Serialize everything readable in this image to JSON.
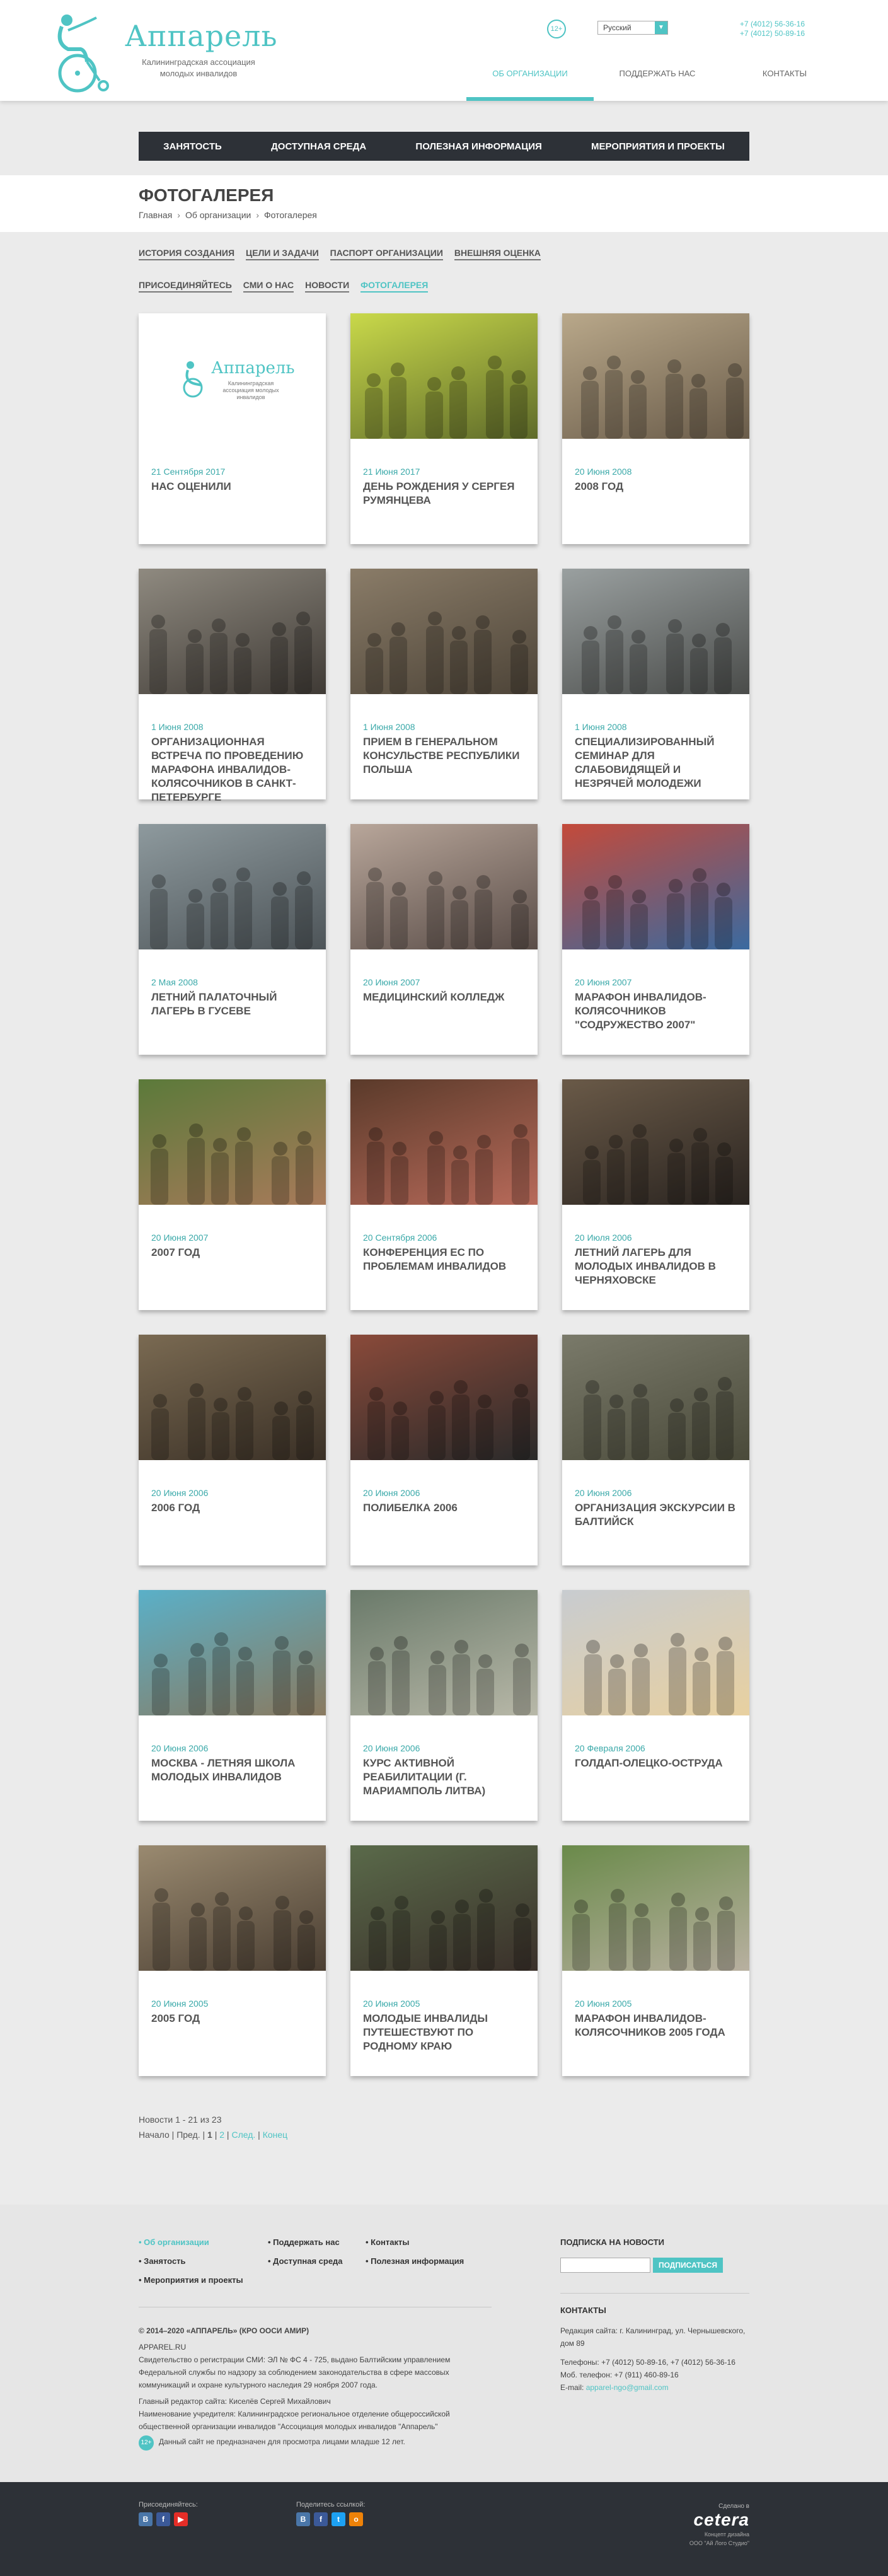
{
  "brand": {
    "name": "Аппарель",
    "subtitle": "Калининградская ассоциация молодых инвалидов",
    "age_badge": "12+",
    "language": "Русский",
    "phones": [
      "+7 (4012) 56-36-16",
      "+7 (4012) 50-89-16"
    ]
  },
  "top_nav": [
    "Об организации",
    "Поддержать нас",
    "Контакты"
  ],
  "section_nav": [
    "Занятость",
    "Доступная среда",
    "Полезная информация",
    "Мероприятия и проекты"
  ],
  "page": {
    "title": "Фотогалерея",
    "breadcrumb": [
      "Главная",
      "Об организации",
      "Фотогалерея"
    ]
  },
  "tabs_row1": [
    "История создания",
    "Цели и задачи",
    "Паспорт организации",
    "Внешняя оценка"
  ],
  "tabs_row2": [
    "Присоединяйтесь",
    "СМИ о нас",
    "Новости",
    "Фотогалерея"
  ],
  "gallery": [
    {
      "date": "21 Сентября 2017",
      "title": "Нас оценили"
    },
    {
      "date": "21 Июня 2017",
      "title": "День рождения у Сергея Румянцева"
    },
    {
      "date": "20 Июня 2008",
      "title": "2008 год"
    },
    {
      "date": "1 Июня 2008",
      "title": "Организационная встреча по проведению марафона инвалидов-колясочников в Санкт-Петербурге"
    },
    {
      "date": "1 Июня 2008",
      "title": "Прием в Генеральном Консульстве Республики Польша"
    },
    {
      "date": "1 Июня 2008",
      "title": "Специализированный семинар для слабовидящей и незрячей молодежи"
    },
    {
      "date": "2 Мая 2008",
      "title": "Летний палаточный лагерь в Гусеве"
    },
    {
      "date": "20 Июня 2007",
      "title": "Медицинский колледж"
    },
    {
      "date": "20 Июня 2007",
      "title": "Марафон инвалидов-колясочников \"Содружество 2007\""
    },
    {
      "date": "20 Июня 2007",
      "title": "2007 год"
    },
    {
      "date": "20 Сентября 2006",
      "title": "Конференция ЕС по проблемам инвалидов"
    },
    {
      "date": "20 Июля 2006",
      "title": "Летний лагерь для молодых инвалидов в Черняховске"
    },
    {
      "date": "20 Июня 2006",
      "title": "2006 год"
    },
    {
      "date": "20 Июня 2006",
      "title": "Полибелка 2006"
    },
    {
      "date": "20 Июня 2006",
      "title": "Организация экскурсии в Балтийск"
    },
    {
      "date": "20 Июня 2006",
      "title": "Москва - Летняя школа молодых инвалидов"
    },
    {
      "date": "20 Июня 2006",
      "title": "Курс активной реабилитации (г. Мариамполь Литва)"
    },
    {
      "date": "20 Февраля 2006",
      "title": "Голдап-Олецко-Оструда"
    },
    {
      "date": "20 Июня 2005",
      "title": "2005 год"
    },
    {
      "date": "20 Июня 2005",
      "title": "Молодые инвалиды путешествуют по родному краю"
    },
    {
      "date": "20 Июня 2005",
      "title": "Марафон инвалидов-колясочников 2005 года"
    }
  ],
  "pager": {
    "summary": "Новости 1 - 21 из 23",
    "start": "Начало",
    "prev": "Пред.",
    "page1": "1",
    "page2": "2",
    "next": "След.",
    "end": "Конец"
  },
  "footer": {
    "menu_col1": [
      "Об организации",
      "Занятость",
      "Мероприятия и проекты"
    ],
    "menu_col2": [
      "Поддержать нас",
      "Доступная среда"
    ],
    "menu_col3": [
      "Контакты",
      "Полезная информация"
    ],
    "copyright": "© 2014–2020 «АППАРЕЛЬ» (КРО ООСИ АМИР)",
    "site": "APPAREL.RU",
    "legal1": "Свидетельство о регистрации СМИ: ЭЛ № ФС 4 - 725, выдано Балтийским управлением Федеральной службы по надзору за соблюдением законодательства в сфере массовых коммуникаций и охране культурного наследия 29 ноября 2007 года.",
    "editor": "Главный редактор сайта: Киселёв Сергей Михайлович",
    "founder": "Наименование учредителя: Калининградское региональное отделение общероссийской общественной организации инвалидов \"Ассоциация молодых инвалидов \"Аппарель\"",
    "age_badge": "12+",
    "age_note": "Данный сайт не предназначен для просмотра лицами младше 12 лет.",
    "subscribe_title": "Подписка на новости",
    "subscribe_button": "Подписаться",
    "contacts_title": "Контакты",
    "address": "Редакция сайта: г. Калининград, ул. Чернышевского, дом 89",
    "phones": "Телефоны: +7 (4012) 50-89-16, +7 (4012) 56-36-16",
    "mobile": "Моб. телефон: +7 (911) 460-89-16",
    "email_label": "E-mail:",
    "email": "apparel-ngo@gmail.com"
  },
  "bottom": {
    "join_label": "Присоединяйтесь:",
    "share_label": "Поделитесь ссылкой:",
    "made_in": "Сделано в",
    "studio": "cetera",
    "design_concept": "Концепт дизайна",
    "design_by": "ООО \"Ай Лого Студио\""
  }
}
